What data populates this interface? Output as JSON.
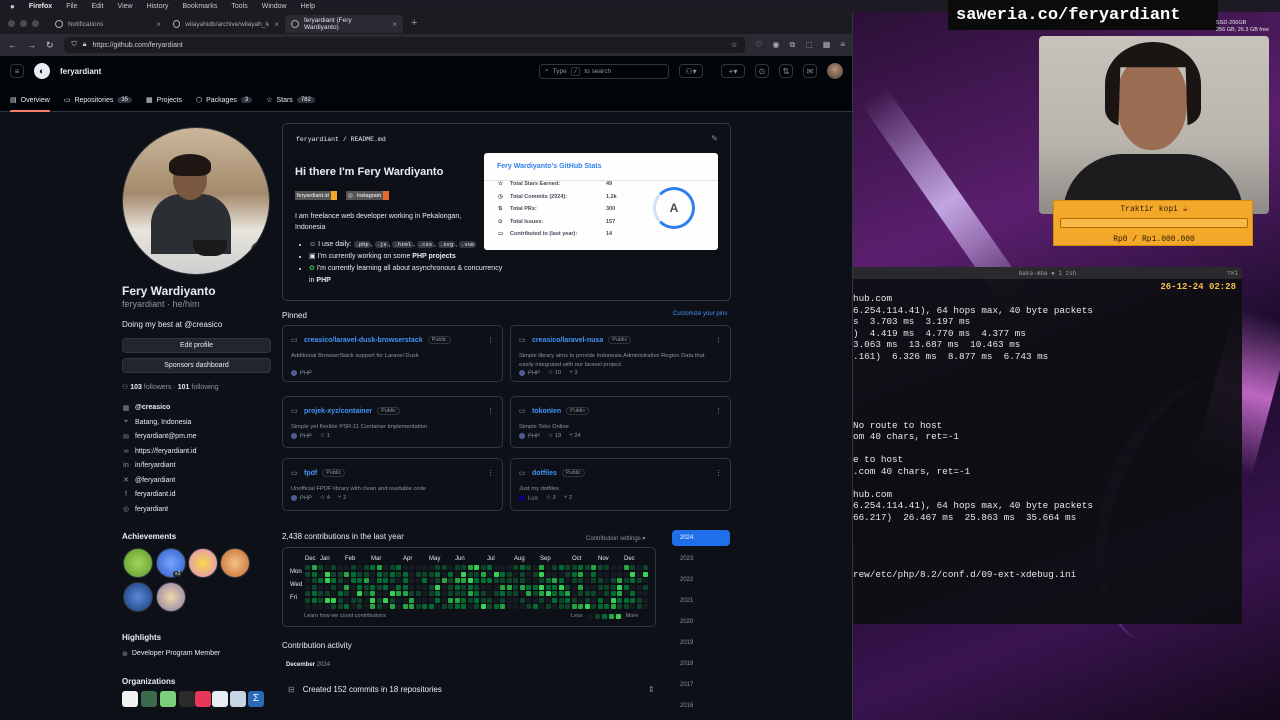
{
  "mac_menu": [
    "Firefox",
    "File",
    "Edit",
    "View",
    "History",
    "Bookmarks",
    "Tools",
    "Window",
    "Help"
  ],
  "tabs": [
    {
      "label": "Notifications",
      "active": false
    },
    {
      "label": "wilayahidb/archive/wilayah_level_",
      "active": false
    },
    {
      "label": "feryardiant (Fery Wardiyanto)",
      "active": true
    }
  ],
  "url": "https://github.com/feryardiant",
  "gh": {
    "user": "feryardiant",
    "search_placeholder": "Type",
    "search_key": "/",
    "search_suffix": "to search",
    "nav": [
      {
        "label": "Overview",
        "count": "",
        "active": true
      },
      {
        "label": "Repositories",
        "count": "35",
        "active": false
      },
      {
        "label": "Projects",
        "count": "",
        "active": false
      },
      {
        "label": "Packages",
        "count": "3",
        "active": false
      },
      {
        "label": "Stars",
        "count": "782",
        "active": false
      }
    ]
  },
  "profile": {
    "name": "Fery Wardiyanto",
    "login_line": "feryardiant · he/him",
    "bio": "Doing my best at @creasico",
    "edit_button": "Edit profile",
    "sponsors_button": "Sponsors dashboard",
    "followers": "103",
    "followers_label": "followers ·",
    "following": "101",
    "following_label": "following",
    "vcard": [
      {
        "icon": "organization-icon",
        "text": "@creasico",
        "bold": true
      },
      {
        "icon": "location-icon",
        "text": "Batang, Indonesia",
        "bold": false
      },
      {
        "icon": "mail-icon",
        "text": "feryardiant@pm.me",
        "bold": false
      },
      {
        "icon": "link-icon",
        "text": "https://feryardiant.id",
        "bold": false
      },
      {
        "icon": "linkedin-icon",
        "text": "in/feryardiant",
        "bold": false
      },
      {
        "icon": "x-icon",
        "text": "@feryardiant",
        "bold": false
      },
      {
        "icon": "facebook-icon",
        "text": "feryardiant.id",
        "bold": false
      },
      {
        "icon": "instagram-icon",
        "text": "feryardiant",
        "bold": false
      }
    ],
    "achievements_title": "Achievements",
    "achievement_count": "x3",
    "highlights_title": "Highlights",
    "highlight_item": "Developer Program Member",
    "organizations_title": "Organizations"
  },
  "readme": {
    "path_user": "feryardiant",
    "path_file": "README.md",
    "title": "Hi there I'm Fery Wardiyanto",
    "shields": [
      {
        "label": "feryardiant.id",
        "color": "#f4a82a"
      },
      {
        "label": "Instagram",
        "color": "#e4692c"
      }
    ],
    "para": "I am freelance web developer working in Pekalongan, Indonesia",
    "bullet1_prefix": "I use daily:",
    "bullet1_codes": [
      ".php",
      ".js",
      ".html",
      ".css",
      ".svg",
      ".vue"
    ],
    "bullet2_prefix": "I'm currently working on some",
    "bullet2_bold": "PHP projects",
    "bullet3_prefix": "I'm currently learning all about asynchronous & concurrency in",
    "bullet3_bold": "PHP"
  },
  "stats_card": {
    "title": "Fery Wardiyanto's GitHub Stats",
    "rows": [
      {
        "label": "Total Stars Earned:",
        "value": "49"
      },
      {
        "label": "Total Commits (2024):",
        "value": "1.2k"
      },
      {
        "label": "Total PRs:",
        "value": "300"
      },
      {
        "label": "Total Issues:",
        "value": "157"
      },
      {
        "label": "Contributed to (last year):",
        "value": "14"
      }
    ],
    "grade": "A"
  },
  "pinned": {
    "title": "Pinned",
    "customize": "Customize your pins",
    "visibility": "Public",
    "repos": [
      {
        "name": "creasico/laravel-dusk-browserstack",
        "desc": "Additional BrowserStack support for Laravel Dusk",
        "lang": "PHP",
        "lang_color": "#4f5d95",
        "stars": "",
        "forks": ""
      },
      {
        "name": "creasico/laravel-nusa",
        "desc": "Simple library aims to provide Indonesia Administrative Region Data that easily integrated with our laravel project.",
        "lang": "PHP",
        "lang_color": "#4f5d95",
        "stars": "10",
        "forks": "3"
      },
      {
        "name": "projek-xyz/container",
        "desc": "Simple yet flexible PSR-11 Container Implementation",
        "lang": "PHP",
        "lang_color": "#4f5d95",
        "stars": "1",
        "forks": ""
      },
      {
        "name": "tokonlen",
        "desc": "Simple Toko Online",
        "lang": "PHP",
        "lang_color": "#4f5d95",
        "stars": "19",
        "forks": "24"
      },
      {
        "name": "fpdf",
        "desc": "Unofficial FPDF library with clean and readable code",
        "lang": "PHP",
        "lang_color": "#4f5d95",
        "stars": "4",
        "forks": "2"
      },
      {
        "name": "dotfiles",
        "desc": "Just my dotfiles",
        "lang": "Lua",
        "lang_color": "#000080",
        "stars": "3",
        "forks": "2"
      }
    ]
  },
  "contributions": {
    "title": "2,438 contributions in the last year",
    "settings": "Contribution settings",
    "months": [
      "Dec",
      "Jan",
      "Feb",
      "Mar",
      "Apr",
      "May",
      "Jun",
      "Jul",
      "Aug",
      "Sep",
      "Oct",
      "Nov",
      "Dec"
    ],
    "days": [
      "Mon",
      "Wed",
      "Fri"
    ],
    "learn": "Learn how we count contributions",
    "less": "Less",
    "more": "More",
    "years": [
      "2024",
      "2023",
      "2022",
      "2021",
      "2020",
      "2019",
      "2018",
      "2017",
      "2016"
    ],
    "active_year": "2024",
    "activity_title": "Contribution activity",
    "month_label": "December",
    "month_year": "2024",
    "commits_line": "Created 152 commits in 18 repositories"
  },
  "stream": {
    "saweria": "saweria.co/feryardiant",
    "disk_label": "SSD-256GB",
    "disk_detail": "256 GB, 26.3 GB free",
    "donate_title": "Traktir kopi ☕",
    "donate_range": "Rp0 / Rp1.000.000",
    "donate_progress": 0
  },
  "terminal": {
    "title": "baka-mba ● 1 zsh",
    "shortcut": "⌥⌘1",
    "clock": "26-12-24 02:28",
    "lines": [
      "hub.com",
      "6.254.114.41), 64 hops max, 40 byte packets",
      "s  3.703 ms  3.197 ms",
      ")  4.419 ms  4.770 ms  4.377 ms",
      "3.063 ms  13.687 ms  10.463 ms",
      ".161)  6.326 ms  8.877 ms  6.743 ms",
      "",
      "",
      "",
      "",
      "",
      "No route to host",
      "om 40 chars, ret=-1",
      "",
      "e to host",
      ".com 40 chars, ret=-1",
      "",
      "hub.com",
      "6.254.114.41), 64 hops max, 40 byte packets",
      "66.217)  26.467 ms  25.863 ms  35.664 ms",
      "",
      "",
      "",
      "",
      "rew/etc/php/8.2/conf.d/09-ext-xdebug.ini"
    ]
  }
}
